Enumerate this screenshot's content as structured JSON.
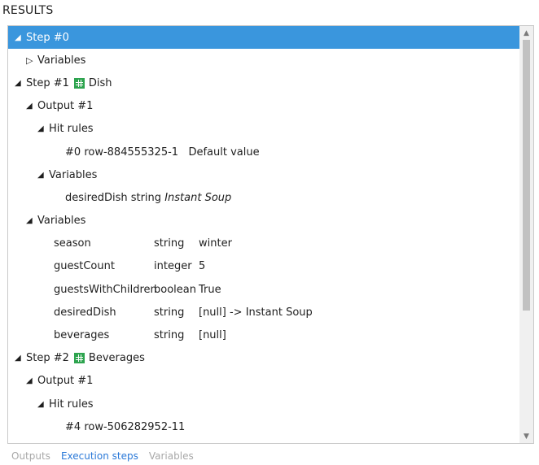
{
  "header": {
    "title": "RESULTS"
  },
  "rows": {
    "step0": "Step #0",
    "step0_variables": "Variables",
    "step1": "Step #1",
    "step1_table": "Dish",
    "step1_output": "Output #1",
    "step1_hitrules": "Hit rules",
    "step1_rule": {
      "id": "#0",
      "row": "row-884555325-1",
      "value": "Default value"
    },
    "step1_out_variables": "Variables",
    "step1_out_var": {
      "name": "desiredDish",
      "type": "string",
      "value": "Instant Soup"
    },
    "step1_variables": "Variables",
    "variables": [
      {
        "name": "season",
        "type": "string",
        "value": "winter"
      },
      {
        "name": "guestCount",
        "type": "integer",
        "value": "5"
      },
      {
        "name": "guestsWithChildren",
        "type": "boolean",
        "value": "True"
      },
      {
        "name": "desiredDish",
        "type": "string",
        "value": "[null] -> Instant Soup"
      },
      {
        "name": "beverages",
        "type": "string",
        "value": "[null]"
      }
    ],
    "step2": "Step #2",
    "step2_table": "Beverages",
    "step2_output": "Output #1",
    "step2_hitrules": "Hit rules",
    "step2_rule": {
      "id": "#4",
      "row": "row-506282952-11"
    }
  },
  "tabs": [
    "Outputs",
    "Execution steps",
    "Variables"
  ],
  "colors": {
    "selection": "#3a96dd",
    "active_tab": "#2b79d8",
    "table_icon": "#2ea44f"
  }
}
